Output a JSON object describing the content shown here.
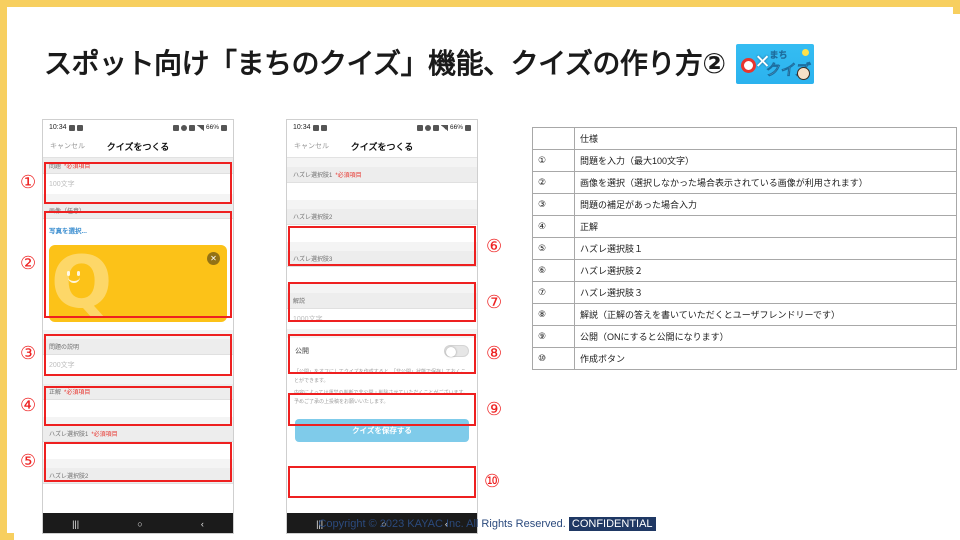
{
  "slide": {
    "title": "スポット向け「まちのクイズ」機能、クイズの作り方②",
    "accent_yellow": "#f7cf5f",
    "marker_red": "#ee2020",
    "logo": {
      "line1": "まち",
      "line2": "クイズ",
      "o_mark": "O",
      "x_mark": "✕",
      "background": "#2bb2ee"
    }
  },
  "phone1": {
    "status": {
      "time": "10:34",
      "battery": "66%"
    },
    "nav": {
      "cancel": "キャンセル",
      "title": "クイズをつくる"
    },
    "fields": {
      "question_label": "問題",
      "question_required": "*必須項目",
      "question_placeholder": "100文字",
      "image_label": "画像（任意）",
      "image_select_link": "写真を選択...",
      "description_label": "問題の説明",
      "description_placeholder": "200文字",
      "answer_label": "正解",
      "answer_required": "*必須項目",
      "wrong1_label": "ハズレ選択肢1",
      "wrong1_required": "*必須項目",
      "wrong2_label": "ハズレ選択肢2"
    },
    "navbuttons": {
      "recents": "|||",
      "home": "○",
      "back": "‹"
    }
  },
  "phone2": {
    "status": {
      "time": "10:34",
      "battery": "66%"
    },
    "nav": {
      "cancel": "キャンセル",
      "title": "クイズをつくる"
    },
    "fields": {
      "wrong1_label": "ハズレ選択肢1",
      "wrong1_required": "*必須項目",
      "wrong2_label": "ハズレ選択肢2",
      "wrong3_label": "ハズレ選択肢3",
      "explain_label": "解説",
      "explain_placeholder": "1000文字",
      "publish_label": "公開"
    },
    "notes": [
      "「公開」をオフにしてクイズを作成すると、「非公開」状態で保存しておくことができます。",
      "内容によっては運営の判断で非公開・削除させていただくことがございます。予めご了承の上投稿をお願いいたします。"
    ],
    "save_button": "クイズを保存する",
    "navbuttons": {
      "recents": "|||",
      "home": "○",
      "back": "‹"
    }
  },
  "markers": {
    "m1": "①",
    "m2": "②",
    "m3": "③",
    "m4": "④",
    "m5": "⑤",
    "m6": "⑥",
    "m7": "⑦",
    "m8": "⑧",
    "m9": "⑨",
    "m10": "⑩"
  },
  "spec_table": {
    "header": {
      "num": "",
      "spec": "仕様"
    },
    "rows": [
      {
        "num": "①",
        "spec": "問題を入力（最大100文字）"
      },
      {
        "num": "②",
        "spec": "画像を選択（選択しなかった場合表示されている画像が利用されます）"
      },
      {
        "num": "③",
        "spec": "問題の補足があった場合入力"
      },
      {
        "num": "④",
        "spec": "正解"
      },
      {
        "num": "⑤",
        "spec": "ハズレ選択肢１"
      },
      {
        "num": "⑥",
        "spec": "ハズレ選択肢２"
      },
      {
        "num": "⑦",
        "spec": "ハズレ選択肢３"
      },
      {
        "num": "⑧",
        "spec": "解説（正解の答えを書いていただくとユーザフレンドリーです）"
      },
      {
        "num": "⑨",
        "spec": "公開（ONにすると公開になります）"
      },
      {
        "num": "⑩",
        "spec": "作成ボタン"
      }
    ]
  },
  "footer": {
    "copyright": "Copyright © 2023 KAYAC Inc. All Rights Reserved.",
    "confidential": "CONFIDENTIAL"
  }
}
